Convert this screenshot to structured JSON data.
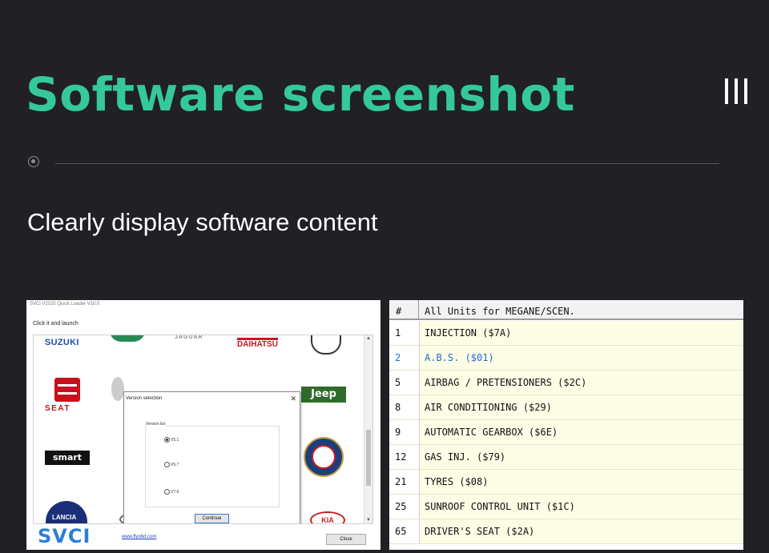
{
  "page": {
    "title": "Software screenshot",
    "subtitle": "Clearly display software content"
  },
  "colors": {
    "accent": "#35c99a",
    "background": "#212025"
  },
  "icons": {
    "menu": "menu-bars-icon",
    "bullet": "target-circle-icon"
  },
  "loader": {
    "window_title": "SVCi V2020 Quick Loader  V10.0",
    "instruction": "Click it and launch",
    "brands": [
      "SUZUKI",
      "JAGUAR",
      "DAIHATSU",
      "Jeep",
      "SEAT",
      "smart"
    ],
    "dialog": {
      "title": "Version selection",
      "group_label": "Version list",
      "options": [
        "V5.1",
        "V5.7",
        "V7.6"
      ],
      "selected": "V5.1",
      "continue_label": "Continue"
    },
    "logo_text": "SVCI",
    "website": "www.flyobd.com",
    "close_label": "Close"
  },
  "units_table": {
    "headers": {
      "num": "#",
      "name": "All Units for MEGANE/SCEN."
    },
    "rows": [
      {
        "num": "1",
        "name": "INJECTION ($7A)"
      },
      {
        "num": "2",
        "name": "A.B.S. ($01)"
      },
      {
        "num": "5",
        "name": "AIRBAG / PRETENSIONERS ($2C)"
      },
      {
        "num": "8",
        "name": "AIR CONDITIONING ($29)"
      },
      {
        "num": "9",
        "name": "AUTOMATIC GEARBOX ($6E)"
      },
      {
        "num": "12",
        "name": "GAS INJ. ($79)"
      },
      {
        "num": "21",
        "name": "TYRES ($08)"
      },
      {
        "num": "25",
        "name": "SUNROOF CONTROL UNIT ($1C)"
      },
      {
        "num": "65",
        "name": "DRIVER'S SEAT ($2A)"
      }
    ],
    "selected_row": "2"
  }
}
